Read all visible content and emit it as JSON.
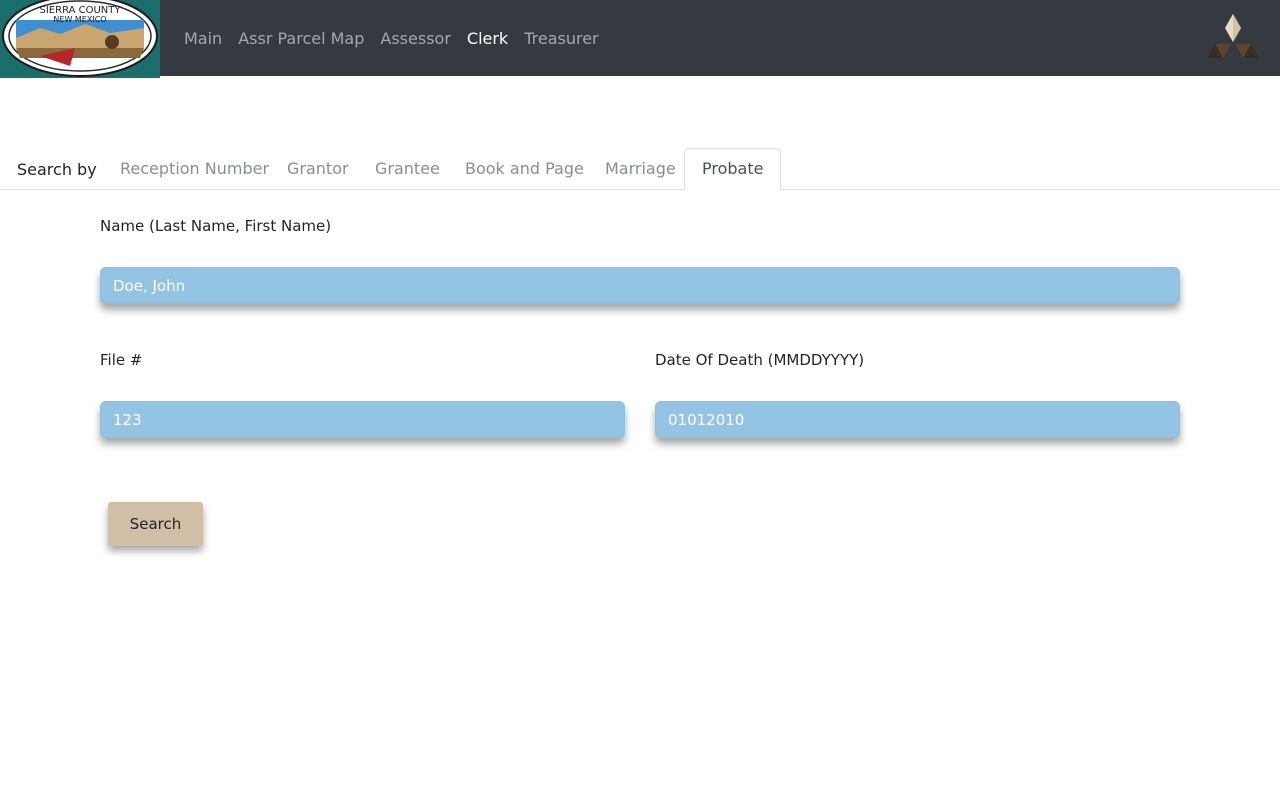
{
  "navbar": {
    "logo": {
      "line1": "SIERRA COUNTY",
      "line2": "NEW MEXICO"
    },
    "links": [
      "Main",
      "Assr Parcel Map",
      "Assessor",
      "Clerk",
      "Treasurer"
    ],
    "active_link": "Clerk"
  },
  "tabs": {
    "prefix": "Search by",
    "items": [
      "Reception Number",
      "Grantor",
      "Grantee",
      "Book and Page",
      "Marriage",
      "Probate"
    ],
    "active": "Probate"
  },
  "form": {
    "name": {
      "label": "Name (Last Name, First Name)",
      "placeholder": "Doe, John"
    },
    "file": {
      "label": "File #",
      "placeholder": "123"
    },
    "dod": {
      "label": "Date Of Death (MMDDYYYY)",
      "placeholder": "01012010"
    },
    "search_label": "Search"
  },
  "colors": {
    "navbar_bg": "#343a40",
    "input_bg": "#93c4e4",
    "button_bg": "#d1bea6",
    "logo_bg": "#1b6e6c"
  }
}
